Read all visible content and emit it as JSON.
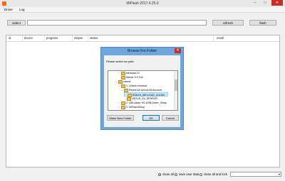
{
  "window": {
    "title": "MiFlash 2017.4.25.0",
    "minimize": "–",
    "maximize": "□",
    "close": "✕"
  },
  "menu": {
    "items": [
      "Driver",
      "Log"
    ]
  },
  "toolbar": {
    "select_label": "select",
    "path_value": "",
    "refresh_label": "refresh",
    "flash_label": "flash"
  },
  "grid": {
    "columns": [
      "id",
      "device",
      "progress",
      "elapse",
      "status",
      "result"
    ]
  },
  "bottom": {
    "options": [
      {
        "label": "clean all",
        "selected": true
      },
      {
        "label": "save user data",
        "selected": false
      },
      {
        "label": "clean all and lock",
        "selected": false
      }
    ],
    "combo_value": ""
  },
  "dialog": {
    "title": "Browse For Folder",
    "close": "✕",
    "prompt": "Please select sw path",
    "tree": [
      {
        "label": "windows 10",
        "expander": "›",
        "level": 2,
        "selected": false
      },
      {
        "label": "Winrar 5.5 Full",
        "expander": "",
        "level": 2,
        "selected": false
      },
      {
        "label": "xiaomi",
        "expander": "⌄",
        "level": 1,
        "selected": false
      },
      {
        "label": "1. Unlock mirobud",
        "expander": "⌄",
        "level": 2,
        "selected": false
      },
      {
        "label": "Redmi 4A Unlock Mi Account",
        "expander": "⌄",
        "level": 3,
        "selected": false
      },
      {
        "label": "ROLEX_MICLOUD_CLEAN",
        "expander": "",
        "level": 4,
        "selected": true
      },
      {
        "label": "UNTUK_ISI_SENSOR",
        "expander": "",
        "level": 4,
        "selected": false
      },
      {
        "label": "2. QDLoader HS-USB Driver_Setup",
        "expander": "›",
        "level": 2,
        "selected": false
      },
      {
        "label": "3. MiFlashSetup",
        "expander": "›",
        "level": 2,
        "selected": false
      }
    ],
    "buttons": {
      "new_folder": "Make New Folder",
      "ok": "OK",
      "cancel": "Cancel"
    }
  },
  "colors": {
    "app_icon": "#f26a1b",
    "close_red": "#c7302a",
    "dialog_frame": "#6ea6de",
    "selection": "#cce8ff"
  }
}
